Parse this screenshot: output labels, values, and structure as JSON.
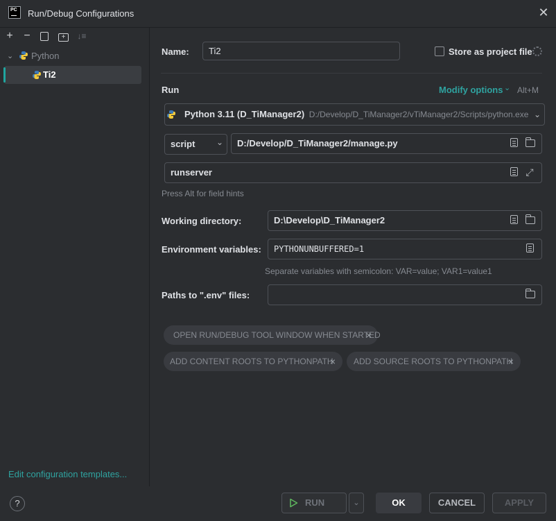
{
  "window": {
    "title": "Run/Debug Configurations",
    "app_icon_text": "PC"
  },
  "sidebar": {
    "toolbar": [
      "add-icon",
      "remove-icon",
      "copy-icon",
      "new-folder-icon",
      "sort-icon"
    ],
    "tree": {
      "group_label": "Python",
      "items": [
        {
          "label": "Ti2"
        }
      ]
    },
    "edit_templates_link": "Edit configuration templates..."
  },
  "form": {
    "name_label": "Name:",
    "name_value": "Ti2",
    "store_label": "Store as project file",
    "run_section": "Run",
    "modify_options": "Modify options",
    "modify_shortcut": "Alt+M",
    "interpreter_name": "Python 3.11 (D_TiManager2)",
    "interpreter_path": "D:/Develop/D_TiManager2/vTiManager2/Scripts/python.exe",
    "script_mode": "script",
    "script_path": "D:/Develop/D_TiManager2/manage.py",
    "parameters": "runserver",
    "field_hint": "Press Alt for field hints",
    "working_dir_label": "Working directory:",
    "working_dir_value": "D:\\Develop\\D_TiManager2",
    "env_label": "Environment variables:",
    "env_value": "PYTHONUNBUFFERED=1",
    "env_hint": "Separate variables with semicolon: VAR=value; VAR1=value1",
    "dotenv_label": "Paths to \".env\" files:",
    "dotenv_value": ""
  },
  "chips": [
    {
      "label": "OPEN RUN/DEBUG TOOL WINDOW WHEN STARTED"
    },
    {
      "label": "ADD CONTENT ROOTS TO PYTHONPATH"
    },
    {
      "label": "ADD SOURCE ROOTS TO PYTHONPATH"
    }
  ],
  "footer": {
    "help": "?",
    "run": "RUN",
    "ok": "OK",
    "cancel": "CANCEL",
    "apply": "APPLY"
  },
  "colors": {
    "background": "#2b2d30",
    "accent": "#2fa3a0",
    "selection": "#3a3d41"
  }
}
